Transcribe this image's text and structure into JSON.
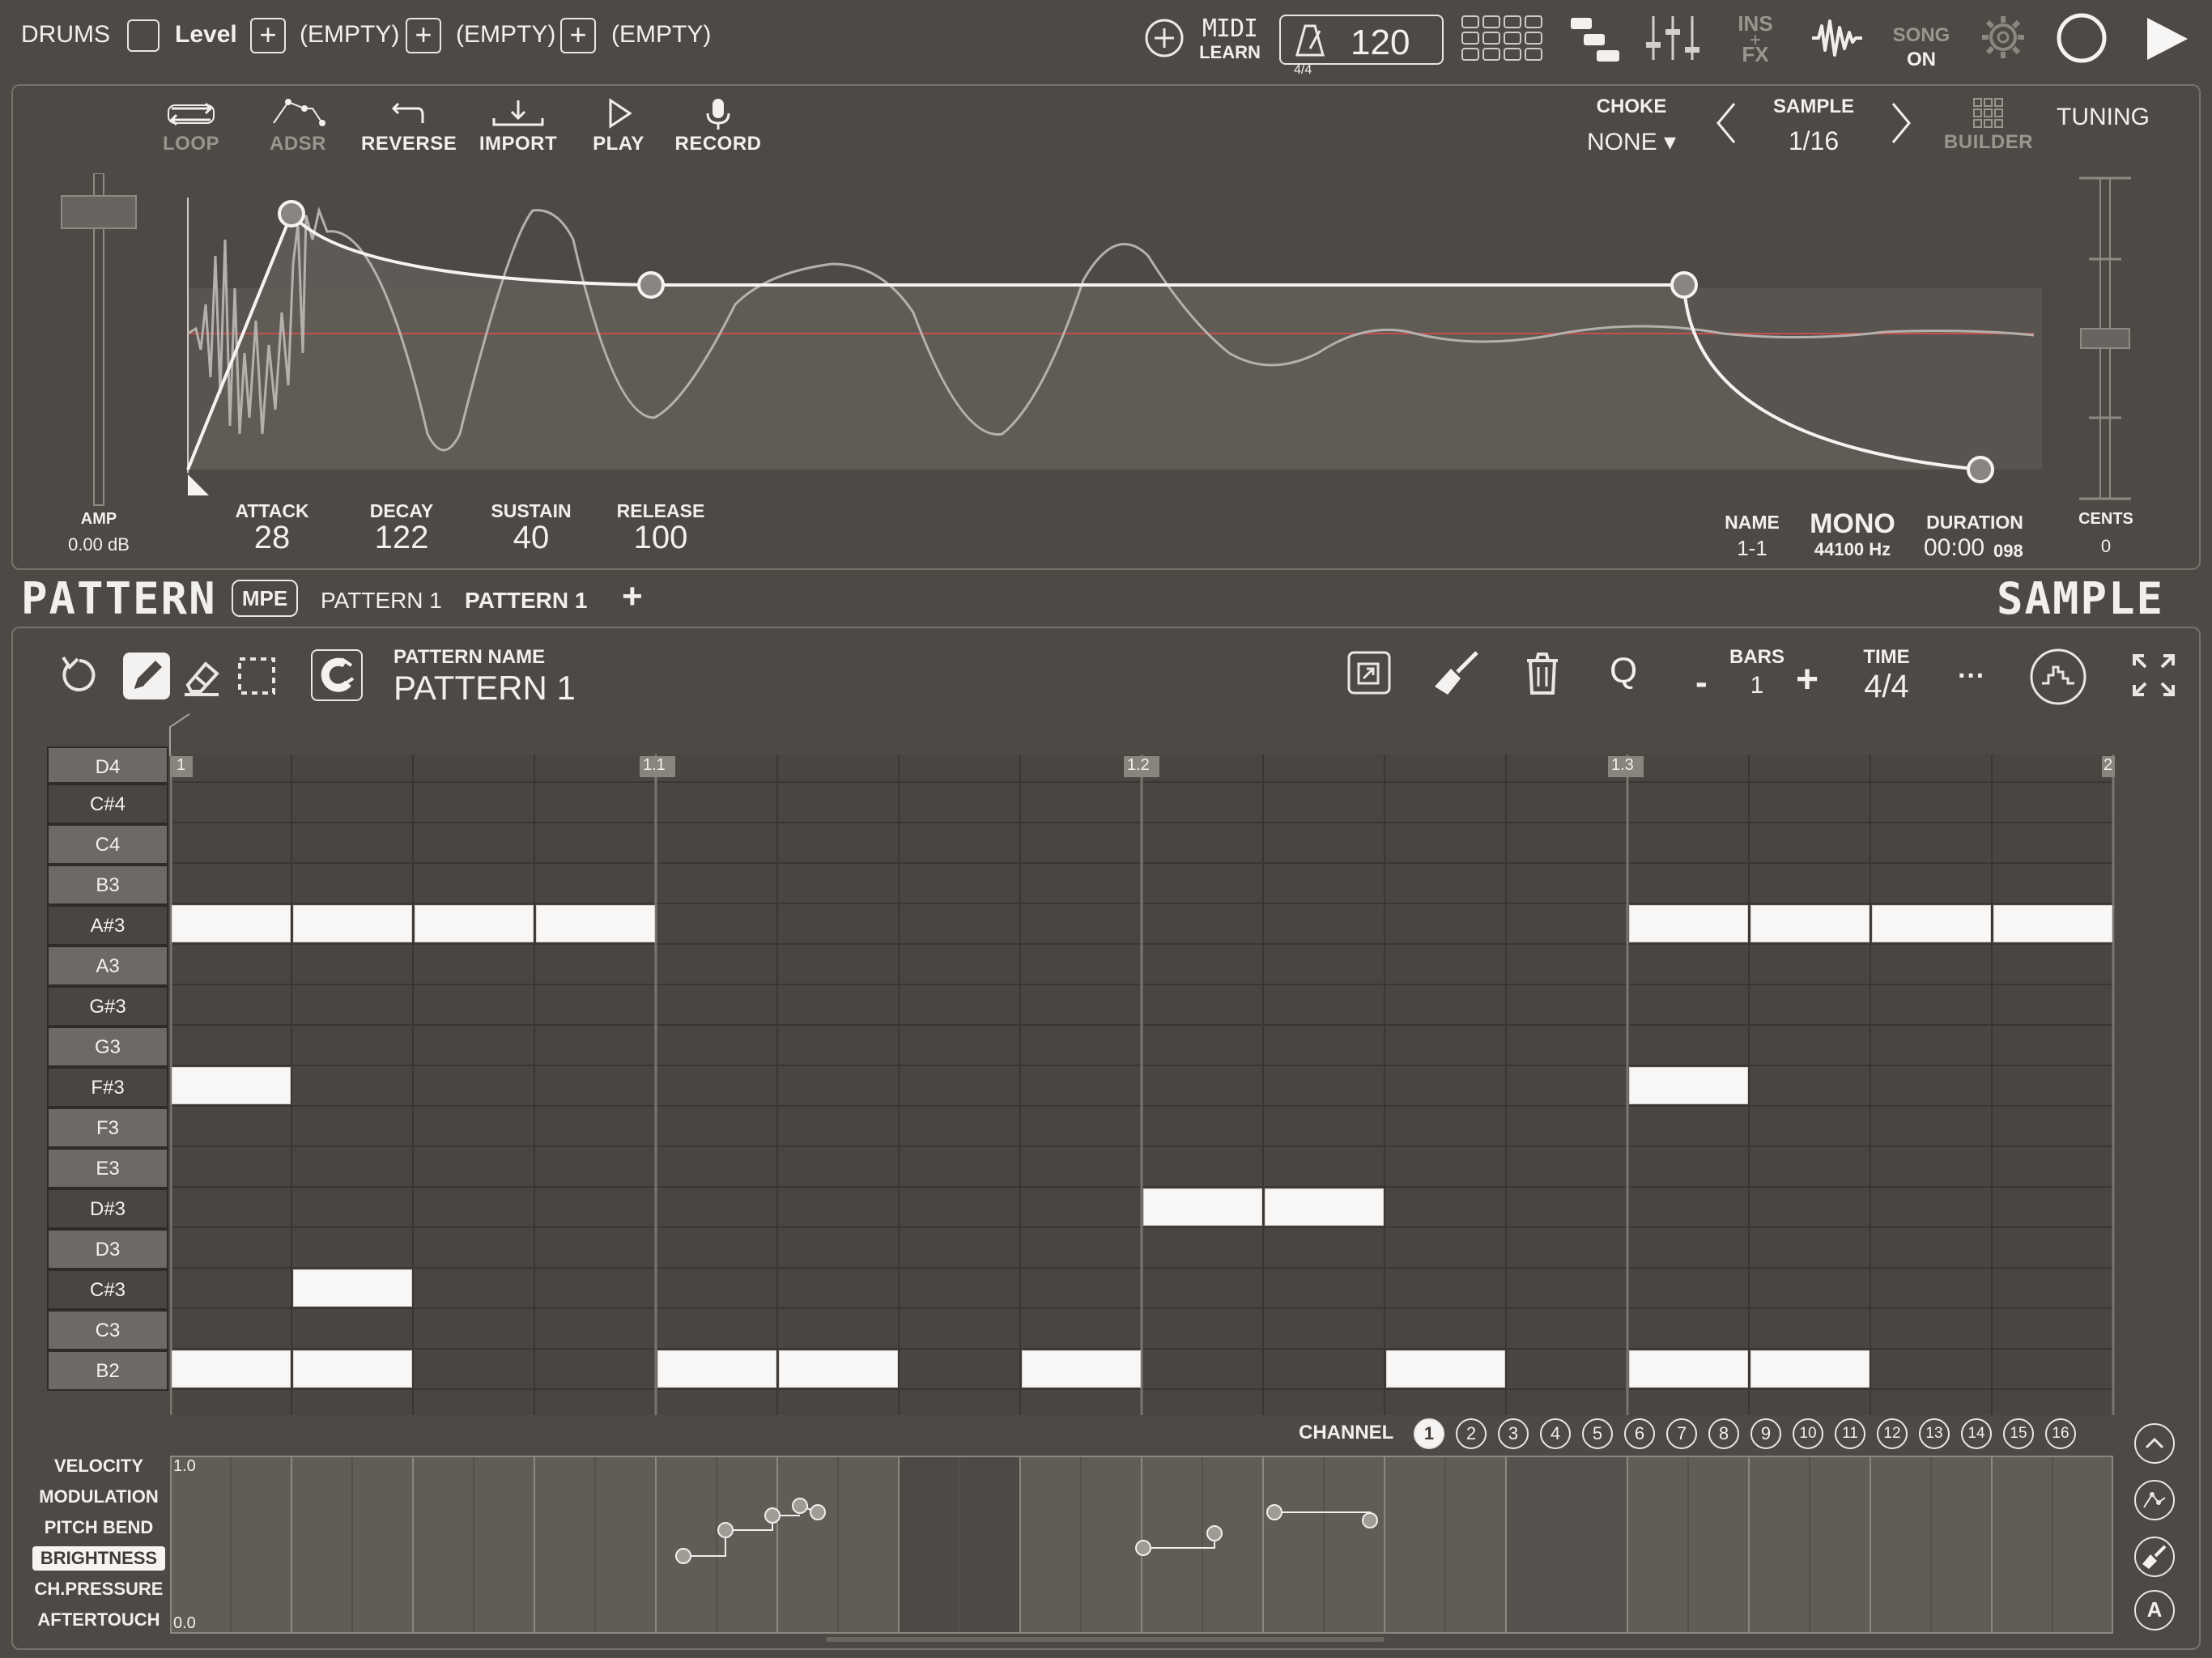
{
  "topbar": {
    "track_name": "DRUMS",
    "level_label": "Level",
    "empty_slots": [
      "(EMPTY)",
      "(EMPTY)",
      "(EMPTY)"
    ],
    "midi_label": "MIDI",
    "learn_label": "LEARN",
    "tempo": "120",
    "time_sig": "4/4",
    "ins_fx_top": "INS",
    "ins_fx_bottom": "FX",
    "song_label": "SONG",
    "song_state": "ON"
  },
  "sample_editor": {
    "tools": [
      {
        "label": "LOOP",
        "icon": "loop-icon",
        "dim": true
      },
      {
        "label": "ADSR",
        "icon": "adsr-icon",
        "dim": true
      },
      {
        "label": "REVERSE",
        "icon": "reverse-icon",
        "dim": false
      },
      {
        "label": "IMPORT",
        "icon": "import-icon",
        "dim": false
      },
      {
        "label": "PLAY",
        "icon": "play-icon",
        "dim": false
      },
      {
        "label": "RECORD",
        "icon": "microphone-icon",
        "dim": false
      }
    ],
    "choke_label": "CHOKE",
    "choke_value": "NONE ▾",
    "sample_label": "SAMPLE",
    "sample_value": "1/16",
    "builder_label": "BUILDER",
    "tuning_label": "TUNING",
    "amp_label": "AMP",
    "amp_value": "0.00 dB",
    "adsr": [
      {
        "label": "ATTACK",
        "value": "28"
      },
      {
        "label": "DECAY",
        "value": "122"
      },
      {
        "label": "SUSTAIN",
        "value": "40"
      },
      {
        "label": "RELEASE",
        "value": "100"
      }
    ],
    "name_label": "NAME",
    "name_value": "1-1",
    "mono_label": "MONO",
    "sample_rate": "44100 Hz",
    "duration_label": "DURATION",
    "duration_value": "00:00",
    "duration_ms": "098",
    "cents_label": "CENTS",
    "cents_value": "0"
  },
  "section_bar": {
    "pattern_title": "PATTERN",
    "mpe_label": "MPE",
    "tabs": [
      "PATTERN 1",
      "PATTERN 1"
    ],
    "add_label": "+",
    "sample_title": "SAMPLE"
  },
  "pattern_editor": {
    "pattern_name_label": "PATTERN NAME",
    "pattern_name": "PATTERN 1",
    "q_label": "Q",
    "bars_label": "BARS",
    "bars_value": "1",
    "minus_label": "-",
    "plus_label": "+",
    "time_label": "TIME",
    "time_value": "4/4",
    "more_label": "···",
    "ruler_labels": [
      "1",
      "1.1",
      "1.2",
      "1.3",
      "2"
    ],
    "keys": [
      "D4",
      "C#4",
      "C4",
      "B3",
      "A#3",
      "A3",
      "G#3",
      "G3",
      "F#3",
      "F3",
      "E3",
      "D#3",
      "D3",
      "C#3",
      "C3",
      "B2"
    ],
    "notes": [
      {
        "key": "B3",
        "steps": [
          0,
          1,
          2,
          3,
          12,
          13,
          14,
          15
        ]
      },
      {
        "key": "G3",
        "steps": [
          0,
          12
        ]
      },
      {
        "key": "E3",
        "steps": [
          8,
          9
        ]
      },
      {
        "key": "D3",
        "steps": [
          1
        ]
      },
      {
        "key": "C3",
        "steps": [
          0,
          1,
          4,
          5,
          7,
          10,
          12,
          13
        ]
      }
    ],
    "channel_label": "CHANNEL",
    "channels": [
      "1",
      "2",
      "3",
      "4",
      "5",
      "6",
      "7",
      "8",
      "9",
      "10",
      "11",
      "12",
      "13",
      "14",
      "15",
      "16"
    ],
    "selected_channel": "1",
    "controllers": [
      "VELOCITY",
      "MODULATION",
      "PITCH BEND",
      "BRIGHTNESS",
      "CH.PRESSURE",
      "AFTERTOUCH"
    ],
    "selected_controller": "BRIGHTNESS",
    "cc_max": "1.0",
    "cc_min": "0.0"
  }
}
